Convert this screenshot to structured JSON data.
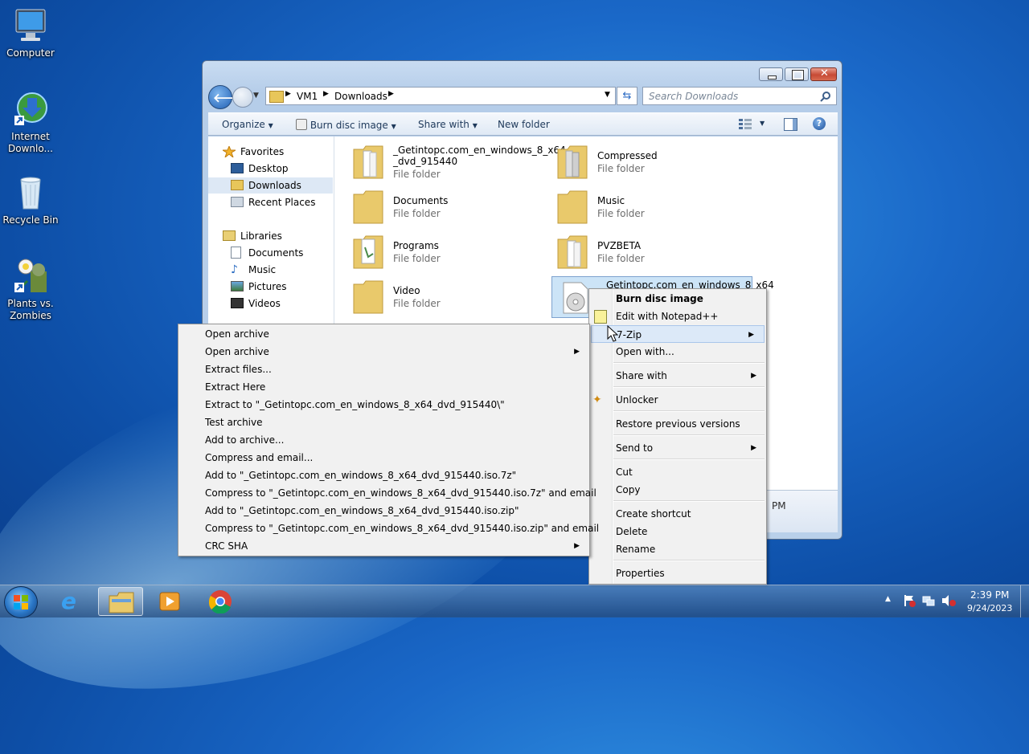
{
  "desktop": {
    "icons": [
      {
        "label": "Computer"
      },
      {
        "label": "Internet Downlo..."
      },
      {
        "label": "Recycle Bin"
      },
      {
        "label": "Plants vs. Zombies"
      }
    ]
  },
  "window": {
    "breadcrumb": [
      "VM1",
      "Downloads"
    ],
    "search_placeholder": "Search Downloads",
    "toolbar": {
      "organize": "Organize",
      "burn": "Burn disc image",
      "share": "Share with",
      "new_folder": "New folder"
    },
    "nav": {
      "favorites": "Favorites",
      "desktop": "Desktop",
      "downloads": "Downloads",
      "recent": "Recent Places",
      "libraries": "Libraries",
      "documents": "Documents",
      "music": "Music",
      "pictures": "Pictures",
      "videos": "Videos"
    },
    "items": [
      {
        "name1": "_Getintopc.com_en_windows_8_x64",
        "name2": "_dvd_915440",
        "type": "File folder"
      },
      {
        "name1": "Compressed",
        "type": "File folder"
      },
      {
        "name1": "Documents",
        "type": "File folder"
      },
      {
        "name1": "Music",
        "type": "File folder"
      },
      {
        "name1": "Programs",
        "type": "File folder"
      },
      {
        "name1": "PVZBETA",
        "type": "File folder"
      },
      {
        "name1": "Video",
        "type": "File folder"
      },
      {
        "name1": "_Getintopc.com_en_windows_8_x64"
      }
    ],
    "details_time": "PM"
  },
  "context_menu": {
    "items": {
      "burn": "Burn disc image",
      "notepad": "Edit with Notepad++",
      "zip": "7-Zip",
      "openwith": "Open with...",
      "share": "Share with",
      "unlocker": "Unlocker",
      "restore": "Restore previous versions",
      "sendto": "Send to",
      "cut": "Cut",
      "copy": "Copy",
      "shortcut": "Create shortcut",
      "delete": "Delete",
      "rename": "Rename",
      "properties": "Properties"
    }
  },
  "zip_menu": {
    "items": [
      "Open archive",
      "Open archive",
      "Extract files...",
      "Extract Here",
      "Extract to \"_Getintopc.com_en_windows_8_x64_dvd_915440\\\"",
      "Test archive",
      "Add to archive...",
      "Compress and email...",
      "Add to \"_Getintopc.com_en_windows_8_x64_dvd_915440.iso.7z\"",
      "Compress to \"_Getintopc.com_en_windows_8_x64_dvd_915440.iso.7z\" and email",
      "Add to \"_Getintopc.com_en_windows_8_x64_dvd_915440.iso.zip\"",
      "Compress to \"_Getintopc.com_en_windows_8_x64_dvd_915440.iso.zip\" and email",
      "CRC SHA"
    ]
  },
  "taskbar": {
    "time": "2:39 PM",
    "date": "9/24/2023"
  }
}
